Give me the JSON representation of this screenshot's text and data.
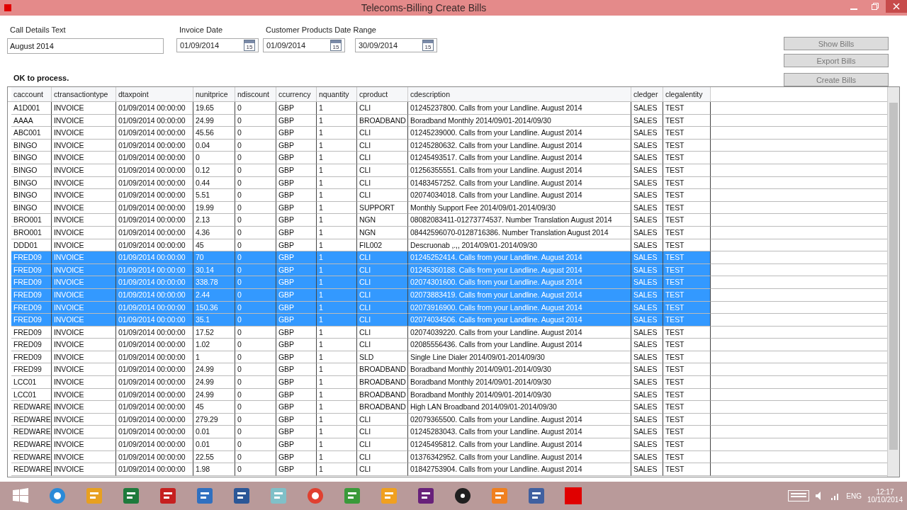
{
  "window": {
    "title": "Telecoms-Billing Create Bills"
  },
  "form": {
    "call_details": {
      "label": "Call Details Text",
      "value": "August 2014"
    },
    "invoice_date": {
      "label": "Invoice Date",
      "value": "01/09/2014",
      "calendar_day": "15"
    },
    "range": {
      "label": "Customer Products Date Range",
      "from": {
        "value": "01/09/2014",
        "calendar_day": "15"
      },
      "to": {
        "value": "30/09/2014",
        "calendar_day": "15"
      }
    },
    "status": "OK to process."
  },
  "buttons": [
    {
      "label": "Show Bills"
    },
    {
      "label": "Export Bills"
    },
    {
      "label": "Create Bills"
    }
  ],
  "table": {
    "columns": [
      "caccount",
      "ctransactiontype",
      "dtaxpoint",
      "nunitprice",
      "ndiscount",
      "ccurrency",
      "nquantity",
      "cproduct",
      "cdescription",
      "cledger",
      "clegalentity"
    ],
    "rows": [
      {
        "selected": false,
        "cells": [
          "A1D001",
          "INVOICE",
          "01/09/2014 00:00:00",
          "19.65",
          "0",
          "GBP",
          "1",
          "CLI",
          "01245237800. Calls from your Landline. August 2014",
          "SALES",
          "TEST"
        ]
      },
      {
        "selected": false,
        "cells": [
          "AAAA",
          "INVOICE",
          "01/09/2014 00:00:00",
          "24.99",
          "0",
          "GBP",
          "1",
          "BROADBAND",
          "Boradband Monthly 2014/09/01-2014/09/30",
          "SALES",
          "TEST"
        ]
      },
      {
        "selected": false,
        "cells": [
          "ABC001",
          "INVOICE",
          "01/09/2014 00:00:00",
          "45.56",
          "0",
          "GBP",
          "1",
          "CLI",
          "01245239000. Calls from your Landline. August 2014",
          "SALES",
          "TEST"
        ]
      },
      {
        "selected": false,
        "cells": [
          "BINGO",
          "INVOICE",
          "01/09/2014 00:00:00",
          "0.04",
          "0",
          "GBP",
          "1",
          "CLI",
          "01245280632. Calls from your Landline. August 2014",
          "SALES",
          "TEST"
        ]
      },
      {
        "selected": false,
        "cells": [
          "BINGO",
          "INVOICE",
          "01/09/2014 00:00:00",
          "0",
          "0",
          "GBP",
          "1",
          "CLI",
          "01245493517. Calls from your Landline. August 2014",
          "SALES",
          "TEST"
        ]
      },
      {
        "selected": false,
        "cells": [
          "BINGO",
          "INVOICE",
          "01/09/2014 00:00:00",
          "0.12",
          "0",
          "GBP",
          "1",
          "CLI",
          "01256355551. Calls from your Landline. August 2014",
          "SALES",
          "TEST"
        ]
      },
      {
        "selected": false,
        "cells": [
          "BINGO",
          "INVOICE",
          "01/09/2014 00:00:00",
          "0.44",
          "0",
          "GBP",
          "1",
          "CLI",
          "01483457252. Calls from your Landline. August 2014",
          "SALES",
          "TEST"
        ]
      },
      {
        "selected": false,
        "cells": [
          "BINGO",
          "INVOICE",
          "01/09/2014 00:00:00",
          "5.51",
          "0",
          "GBP",
          "1",
          "CLI",
          "02074034018. Calls from your Landline. August 2014",
          "SALES",
          "TEST"
        ]
      },
      {
        "selected": false,
        "cells": [
          "BINGO",
          "INVOICE",
          "01/09/2014 00:00:00",
          "19.99",
          "0",
          "GBP",
          "1",
          "SUPPORT",
          "Monthly Support Fee 2014/09/01-2014/09/30",
          "SALES",
          "TEST"
        ]
      },
      {
        "selected": false,
        "cells": [
          "BRO001",
          "INVOICE",
          "01/09/2014 00:00:00",
          "2.13",
          "0",
          "GBP",
          "1",
          "NGN",
          "08082083411-01273774537. Number Translation August 2014",
          "SALES",
          "TEST"
        ]
      },
      {
        "selected": false,
        "cells": [
          "BRO001",
          "INVOICE",
          "01/09/2014 00:00:00",
          "4.36",
          "0",
          "GBP",
          "1",
          "NGN",
          "08442596070-0128716386. Number Translation August 2014",
          "SALES",
          "TEST"
        ]
      },
      {
        "selected": false,
        "cells": [
          "DDD01",
          "INVOICE",
          "01/09/2014 00:00:00",
          "45",
          "0",
          "GBP",
          "1",
          "FIL002",
          "Descruonab ,.,, 2014/09/01-2014/09/30",
          "SALES",
          "TEST"
        ]
      },
      {
        "selected": true,
        "cells": [
          "FRED09",
          "INVOICE",
          "01/09/2014 00:00:00",
          "70",
          "0",
          "GBP",
          "1",
          "CLI",
          "01245252414. Calls from your Landline. August 2014",
          "SALES",
          "TEST"
        ]
      },
      {
        "selected": true,
        "cells": [
          "FRED09",
          "INVOICE",
          "01/09/2014 00:00:00",
          "30.14",
          "0",
          "GBP",
          "1",
          "CLI",
          "01245360188. Calls from your Landline. August 2014",
          "SALES",
          "TEST"
        ]
      },
      {
        "selected": true,
        "cells": [
          "FRED09",
          "INVOICE",
          "01/09/2014 00:00:00",
          "338.78",
          "0",
          "GBP",
          "1",
          "CLI",
          "02074301600. Calls from your Landline. August 2014",
          "SALES",
          "TEST"
        ]
      },
      {
        "selected": true,
        "cells": [
          "FRED09",
          "INVOICE",
          "01/09/2014 00:00:00",
          "2.44",
          "0",
          "GBP",
          "1",
          "CLI",
          "02073883419. Calls from your Landline. August 2014",
          "SALES",
          "TEST"
        ]
      },
      {
        "selected": true,
        "cells": [
          "FRED09",
          "INVOICE",
          "01/09/2014 00:00:00",
          "150.36",
          "0",
          "GBP",
          "1",
          "CLI",
          "02073916900. Calls from your Landline. August 2014",
          "SALES",
          "TEST"
        ]
      },
      {
        "selected": true,
        "cells": [
          "FRED09",
          "INVOICE",
          "01/09/2014 00:00:00",
          "35.1",
          "0",
          "GBP",
          "1",
          "CLI",
          "02074034506. Calls from your Landline. August 2014",
          "SALES",
          "TEST"
        ]
      },
      {
        "selected": false,
        "cells": [
          "FRED09",
          "INVOICE",
          "01/09/2014 00:00:00",
          "17.52",
          "0",
          "GBP",
          "1",
          "CLI",
          "02074039220. Calls from your Landline. August 2014",
          "SALES",
          "TEST"
        ]
      },
      {
        "selected": false,
        "cells": [
          "FRED09",
          "INVOICE",
          "01/09/2014 00:00:00",
          "1.02",
          "0",
          "GBP",
          "1",
          "CLI",
          "02085556436. Calls from your Landline. August 2014",
          "SALES",
          "TEST"
        ]
      },
      {
        "selected": false,
        "cells": [
          "FRED09",
          "INVOICE",
          "01/09/2014 00:00:00",
          "1",
          "0",
          "GBP",
          "1",
          "SLD",
          "Single Line Dialer 2014/09/01-2014/09/30",
          "SALES",
          "TEST"
        ]
      },
      {
        "selected": false,
        "cells": [
          "FRED99",
          "INVOICE",
          "01/09/2014 00:00:00",
          "24.99",
          "0",
          "GBP",
          "1",
          "BROADBAND",
          "Boradband Monthly 2014/09/01-2014/09/30",
          "SALES",
          "TEST"
        ]
      },
      {
        "selected": false,
        "cells": [
          "LCC01",
          "INVOICE",
          "01/09/2014 00:00:00",
          "24.99",
          "0",
          "GBP",
          "1",
          "BROADBAND",
          "Boradband Monthly 2014/09/01-2014/09/30",
          "SALES",
          "TEST"
        ]
      },
      {
        "selected": false,
        "cells": [
          "LCC01",
          "INVOICE",
          "01/09/2014 00:00:00",
          "24.99",
          "0",
          "GBP",
          "1",
          "BROADBAND",
          "Boradband Monthly 2014/09/01-2014/09/30",
          "SALES",
          "TEST"
        ]
      },
      {
        "selected": false,
        "cells": [
          "REDWARE",
          "INVOICE",
          "01/09/2014 00:00:00",
          "45",
          "0",
          "GBP",
          "1",
          "BROADBAND",
          "High LAN Broadband 2014/09/01-2014/09/30",
          "SALES",
          "TEST"
        ]
      },
      {
        "selected": false,
        "cells": [
          "REDWARE",
          "INVOICE",
          "01/09/2014 00:00:00",
          "279.29",
          "0",
          "GBP",
          "1",
          "CLI",
          "02079365500. Calls from your Landline. August 2014",
          "SALES",
          "TEST"
        ]
      },
      {
        "selected": false,
        "cells": [
          "REDWARE",
          "INVOICE",
          "01/09/2014 00:00:00",
          "0.01",
          "0",
          "GBP",
          "1",
          "CLI",
          "01245283043. Calls from your Landline. August 2014",
          "SALES",
          "TEST"
        ]
      },
      {
        "selected": false,
        "cells": [
          "REDWARE",
          "INVOICE",
          "01/09/2014 00:00:00",
          "0.01",
          "0",
          "GBP",
          "1",
          "CLI",
          "01245495812. Calls from your Landline. August 2014",
          "SALES",
          "TEST"
        ]
      },
      {
        "selected": false,
        "cells": [
          "REDWARE",
          "INVOICE",
          "01/09/2014 00:00:00",
          "22.55",
          "0",
          "GBP",
          "1",
          "CLI",
          "01376342952. Calls from your Landline. August 2014",
          "SALES",
          "TEST"
        ]
      },
      {
        "selected": false,
        "cells": [
          "REDWARE",
          "INVOICE",
          "01/09/2014 00:00:00",
          "1.98",
          "0",
          "GBP",
          "1",
          "CLI",
          "01842753904. Calls from your Landline. August 2014",
          "SALES",
          "TEST"
        ]
      }
    ]
  },
  "taskbar": {
    "apps": [
      {
        "kind": "browser",
        "color": "#2a8ad8"
      },
      {
        "kind": "mail",
        "color": "#e8a020"
      },
      {
        "kind": "sheet",
        "color": "#1e7a3c"
      },
      {
        "kind": "ftp",
        "color": "#c62020"
      },
      {
        "kind": "remote",
        "color": "#3070c0"
      },
      {
        "kind": "doc",
        "color": "#2b5797"
      },
      {
        "kind": "note",
        "color": "#80c0c8"
      },
      {
        "kind": "chrome",
        "color": "#e04030"
      },
      {
        "kind": "tracker",
        "color": "#3a9a3a"
      },
      {
        "kind": "meeting",
        "color": "#f0a020"
      },
      {
        "kind": "studio",
        "color": "#68217a"
      },
      {
        "kind": "recorder",
        "color": "#202020"
      },
      {
        "kind": "player",
        "color": "#f08020"
      },
      {
        "kind": "save",
        "color": "#4060a0"
      },
      {
        "kind": "stop",
        "color": "#e00000"
      }
    ],
    "language": "ENG",
    "time": "12:17",
    "date": "10/10/2014"
  }
}
